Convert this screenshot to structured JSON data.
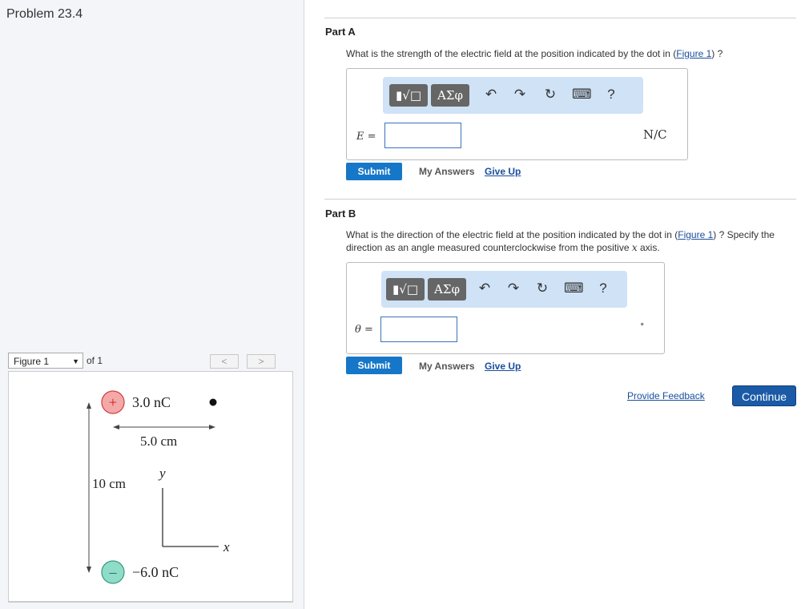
{
  "problem": {
    "title": "Problem 23.4"
  },
  "figure": {
    "selector_label": "Figure 1",
    "of_label": "of 1",
    "prev_label": "<",
    "next_label": ">",
    "charge_pos_sign": "+",
    "charge_pos_label": "3.0 nC",
    "charge_neg_sign": "–",
    "charge_neg_label": "−6.0 nC",
    "spacing_label": "5.0 cm",
    "height_label": "10 cm",
    "axis_y_label": "y",
    "axis_x_label": "x"
  },
  "part_a": {
    "title": "Part A",
    "question_prefix": "What is the strength of the electric field at the position indicated by the dot in (",
    "figure_link": "Figure 1",
    "question_suffix": ") ?",
    "toolbar": {
      "templates": "▮√□",
      "symbols": "ΑΣφ",
      "help": "?"
    },
    "variable_label": "E =",
    "input_value": "",
    "unit": "N/C",
    "submit_label": "Submit",
    "my_answers_label": "My Answers",
    "give_up_label": "Give Up"
  },
  "part_b": {
    "title": "Part B",
    "question_prefix": "What is the direction of the electric field at the position indicated by the dot in (",
    "figure_link": "Figure 1",
    "question_suffix_1": ") ? Specify the direction as an angle measured counterclockwise from the positive ",
    "question_var": "x",
    "question_suffix_2": " axis.",
    "toolbar": {
      "templates": "▮√□",
      "symbols": "ΑΣφ",
      "help": "?"
    },
    "variable_label": "θ =",
    "input_value": "",
    "unit": "∘",
    "submit_label": "Submit",
    "my_answers_label": "My Answers",
    "give_up_label": "Give Up"
  },
  "footer": {
    "feedback_label": "Provide Feedback",
    "continue_label": "Continue"
  }
}
